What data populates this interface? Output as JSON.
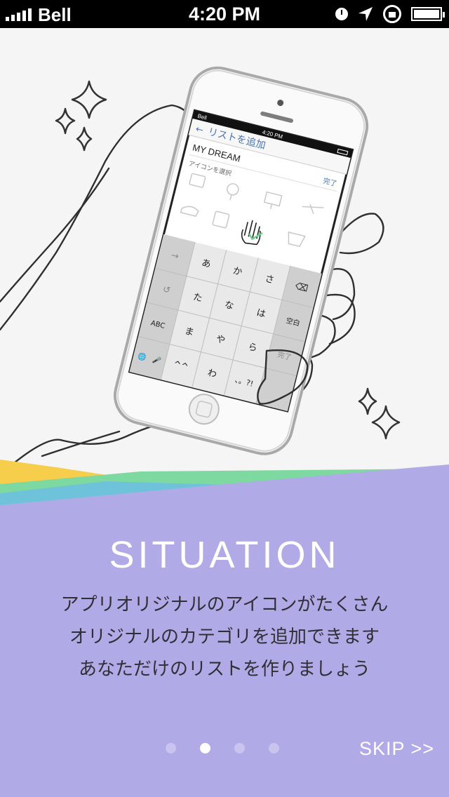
{
  "status_bar": {
    "carrier": "Bell",
    "time": "4:20 PM",
    "icons": [
      "signal-icon",
      "clock-icon",
      "location-icon",
      "rotation-lock-icon",
      "battery-icon"
    ]
  },
  "phone": {
    "carrier": "Bell",
    "time": "4:20 PM",
    "nav_title": "リストを追加",
    "list_name": "MY DREAM",
    "done": "完了",
    "icon_prompt": "アイコンを選択",
    "keyboard": {
      "row1": [
        "→",
        "あ",
        "か",
        "さ",
        "⌫"
      ],
      "row2": [
        "↺",
        "た",
        "な",
        "は",
        "空白"
      ],
      "row3": [
        "ABC",
        "ま",
        "や",
        "ら",
        "完了"
      ],
      "row4": [
        "🌐",
        "🎤",
        "^^",
        "わ",
        "、。?!"
      ]
    }
  },
  "onboarding": {
    "title": "SITUATION",
    "lines": [
      "アプリオリジナルのアイコンがたくさん",
      "オリジナルのカテゴリを追加できます",
      "あなただけのリストを作りましょう"
    ],
    "page_count": 4,
    "current_page": 2,
    "skip": "SKIP >>"
  },
  "colors": {
    "panel": "#b0abe6",
    "yellow_band": "#f6ce4b",
    "green_band": "#7ed9a0",
    "blue_band": "#6ec3da",
    "background": "#f4f5f4"
  }
}
